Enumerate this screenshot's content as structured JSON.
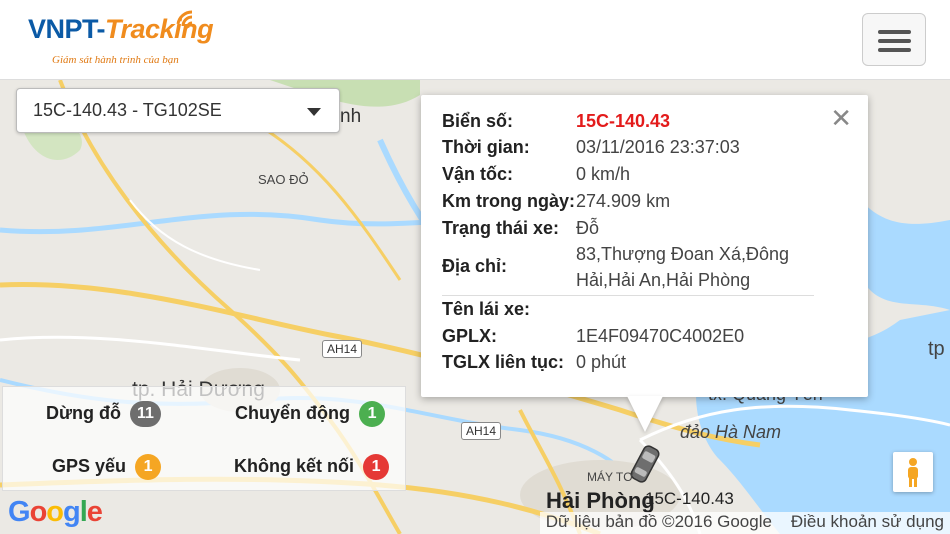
{
  "header": {
    "logo_main": "VNPT-",
    "logo_accent": "Tracking",
    "logo_sub": "Giám sát hành trình của bạn",
    "menu_icon": "hamburger-icon"
  },
  "vehicle_select": {
    "value": "15C-140.43 - TG102SE"
  },
  "popup": {
    "rows": [
      {
        "key": "Biển số:",
        "value": "15C-140.43"
      },
      {
        "key": "Thời gian:",
        "value": "03/11/2016 23:37:03"
      },
      {
        "key": "Vận tốc:",
        "value": "0 km/h"
      },
      {
        "key": "Km trong ngày:",
        "value": "274.909 km"
      },
      {
        "key": "Trạng thái xe:",
        "value": "Đỗ"
      },
      {
        "key": "Địa chỉ:",
        "value_line1": "83,Thượng Đoan Xá,Đông",
        "value_line2": "Hải,Hải An,Hải Phòng"
      },
      {
        "key": "Tên lái xe:",
        "value": ""
      },
      {
        "key": "GPLX:",
        "value": "1E4F09470C4002E0"
      },
      {
        "key": "TGLX liên tục:",
        "value": "0 phút"
      }
    ],
    "close_icon": "close-icon"
  },
  "legend": {
    "items": [
      {
        "label": "Dừng đỗ",
        "count": "11",
        "color": "#6e6e6e"
      },
      {
        "label": "Chuyển động",
        "count": "1",
        "color": "#4caf50"
      },
      {
        "label": "GPS yếu",
        "count": "1",
        "color": "#f5a623"
      },
      {
        "label": "Không kết nối",
        "count": "1",
        "color": "#e53935"
      }
    ]
  },
  "map": {
    "labels": {
      "sao_do": "SAO ĐỎ",
      "hai_duong": "tp. Hải Dương",
      "hai_phong": "Hải Phòng",
      "may_to": "MÁY TƠ",
      "quang_yen": "tx. Quảng Yên",
      "dao_ha_nam": "đảo Hà Nam",
      "tp_right": "tp",
      "nh": "nh"
    },
    "roads": [
      "AH14",
      "AH14"
    ],
    "marker_label": "15C-140.43",
    "google": "Google",
    "attribution": "Dữ liệu bản đồ ©2016 Google",
    "terms": "Điều khoản sử dụng"
  }
}
